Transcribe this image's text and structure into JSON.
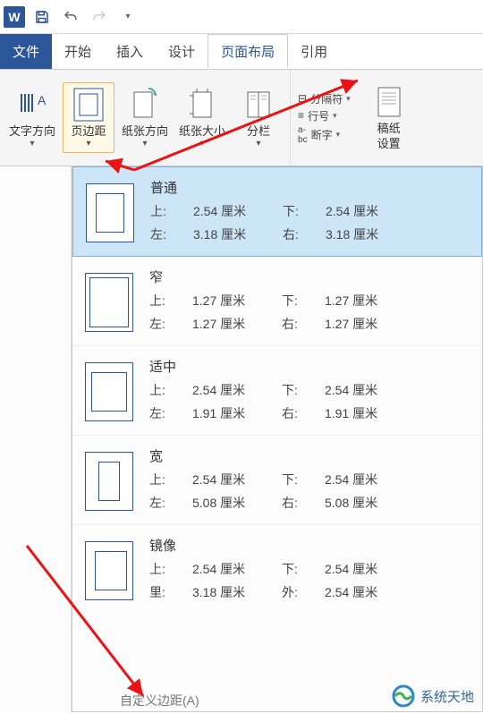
{
  "app": {
    "icon_letter": "W"
  },
  "tabs": {
    "file": "文件",
    "home": "开始",
    "insert": "插入",
    "design": "设计",
    "layout": "页面布局",
    "references": "引用"
  },
  "ribbon": {
    "text_direction": "文字方向",
    "margins": "页边距",
    "orientation": "纸张方向",
    "size": "纸张大小",
    "columns": "分栏",
    "breaks": "分隔符",
    "line_numbers": "行号",
    "hyphenation": "断字",
    "stationery": "稿纸",
    "stationery2": "设置"
  },
  "dropdown": {
    "items": [
      {
        "name": "普通",
        "top_label": "上:",
        "top_val": "2.54 厘米",
        "bottom_label": "下:",
        "bottom_val": "2.54 厘米",
        "left_label": "左:",
        "left_val": "3.18 厘米",
        "right_label": "右:",
        "right_val": "3.18 厘米",
        "icon": "normal",
        "selected": true
      },
      {
        "name": "窄",
        "top_label": "上:",
        "top_val": "1.27 厘米",
        "bottom_label": "下:",
        "bottom_val": "1.27 厘米",
        "left_label": "左:",
        "left_val": "1.27 厘米",
        "right_label": "右:",
        "right_val": "1.27 厘米",
        "icon": "narrow",
        "selected": false
      },
      {
        "name": "适中",
        "top_label": "上:",
        "top_val": "2.54 厘米",
        "bottom_label": "下:",
        "bottom_val": "2.54 厘米",
        "left_label": "左:",
        "left_val": "1.91 厘米",
        "right_label": "右:",
        "right_val": "1.91 厘米",
        "icon": "moderate",
        "selected": false
      },
      {
        "name": "宽",
        "top_label": "上:",
        "top_val": "2.54 厘米",
        "bottom_label": "下:",
        "bottom_val": "2.54 厘米",
        "left_label": "左:",
        "left_val": "5.08 厘米",
        "right_label": "右:",
        "right_val": "5.08 厘米",
        "icon": "wide",
        "selected": false
      },
      {
        "name": "镜像",
        "top_label": "上:",
        "top_val": "2.54 厘米",
        "bottom_label": "下:",
        "bottom_val": "2.54 厘米",
        "left_label": "里:",
        "left_val": "3.18 厘米",
        "right_label": "外:",
        "right_val": "2.54 厘米",
        "icon": "mirror",
        "selected": false
      }
    ],
    "custom": "自定义边距(A)"
  },
  "watermark": "系统天地"
}
